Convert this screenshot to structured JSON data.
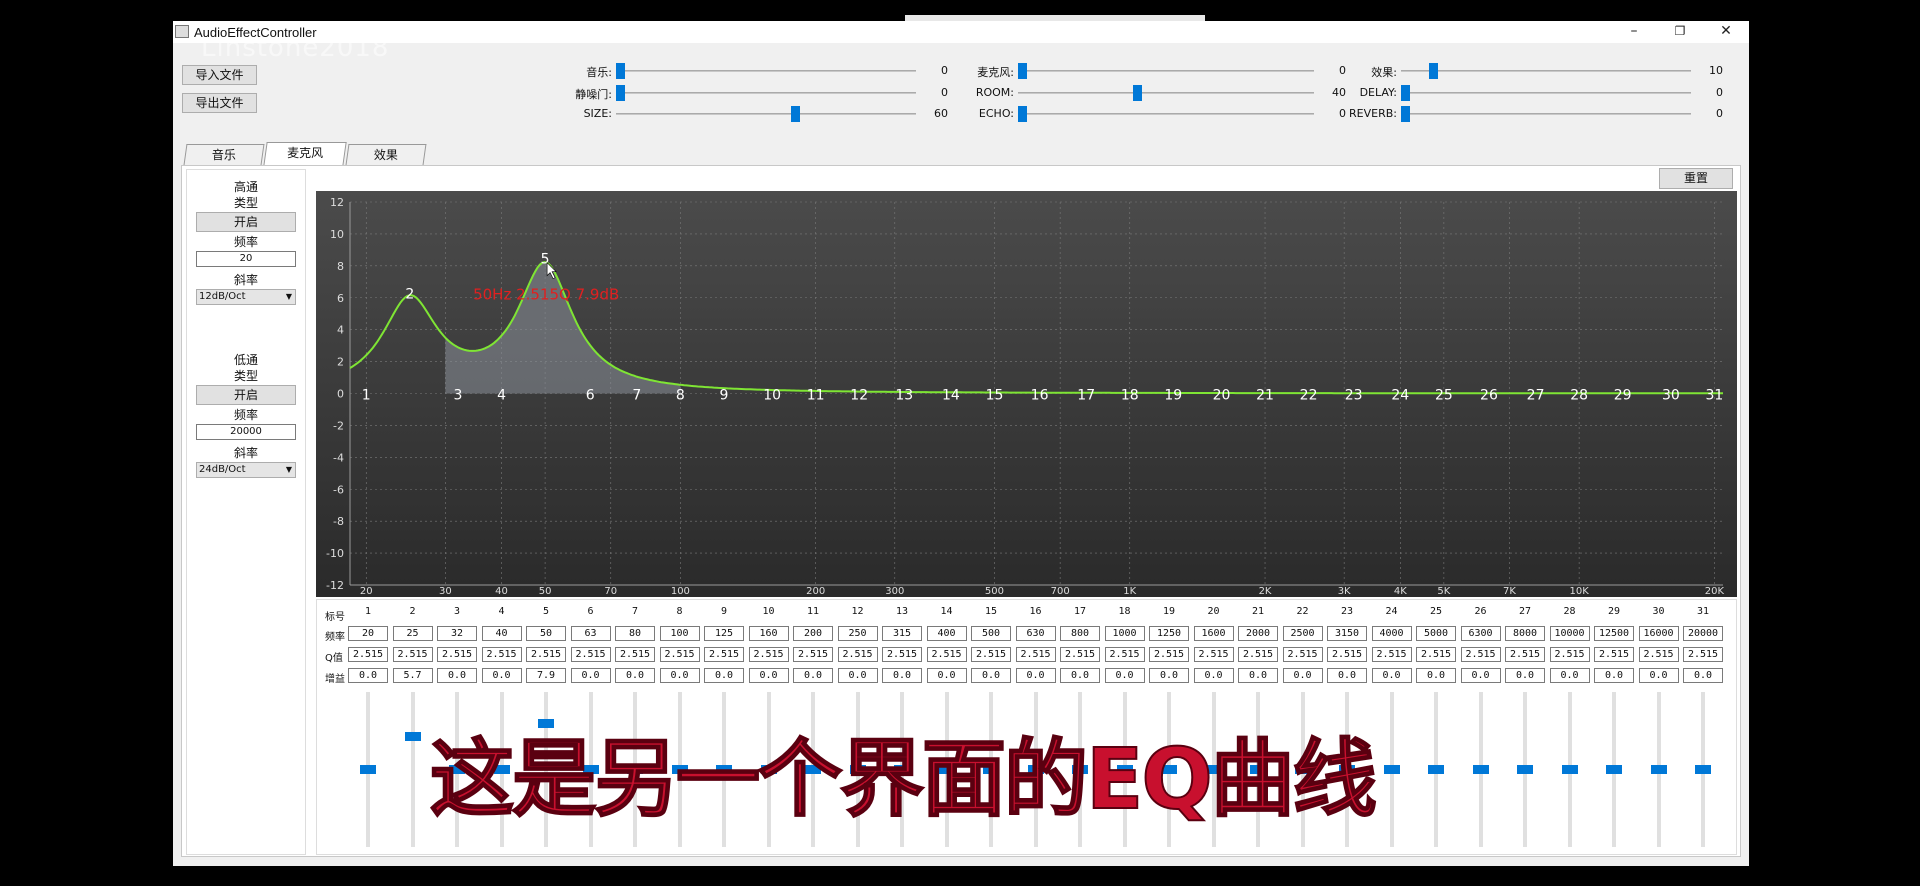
{
  "window": {
    "title": "AudioEffectController"
  },
  "watermark": "Linstone2018",
  "buttons": {
    "import": "导入文件",
    "export": "导出文件",
    "reset": "重置"
  },
  "sliders": [
    {
      "label": "音乐:",
      "value": "0",
      "level": 0.0
    },
    {
      "label": "麦克风:",
      "value": "0",
      "level": 0.0
    },
    {
      "label": "效果:",
      "value": "10",
      "level": 0.1
    },
    {
      "label": "静噪门:",
      "value": "0",
      "level": 0.0
    },
    {
      "label": "ROOM:",
      "value": "40",
      "level": 0.4
    },
    {
      "label": "DELAY:",
      "value": "0",
      "level": 0.0
    },
    {
      "label": "SIZE:",
      "value": "60",
      "level": 0.6
    },
    {
      "label": "ECHO:",
      "value": "0",
      "level": 0.0
    },
    {
      "label": "REVERB:",
      "value": "0",
      "level": 0.0
    }
  ],
  "tabs": [
    "音乐",
    "麦克风",
    "效果"
  ],
  "active_tab": "麦克风",
  "left_panel": {
    "highpass": {
      "title": "高通",
      "type_label": "类型",
      "button": "开启",
      "freq_label": "频率",
      "freq_value": "20",
      "slope_label": "斜率",
      "slope_value": "12dB/Oct"
    },
    "lowpass": {
      "title": "低通",
      "type_label": "类型",
      "button": "开启",
      "freq_label": "频率",
      "freq_value": "20000",
      "slope_label": "斜率",
      "slope_value": "24dB/Oct"
    }
  },
  "chart_data": {
    "type": "line",
    "yticks": [
      "12",
      "10",
      "8",
      "6",
      "4",
      "2",
      "0",
      "-2",
      "-4",
      "-6",
      "-8",
      "-10",
      "-12"
    ],
    "ylim": [
      -12,
      12
    ],
    "xscale": "log",
    "xticks": [
      "20",
      "30",
      "40",
      "50",
      "70",
      "100",
      "200",
      "300",
      "500",
      "700",
      "1K",
      "2K",
      "3K",
      "4K",
      "5K",
      "7K",
      "10K",
      "20K"
    ],
    "xtick_values": [
      20,
      30,
      40,
      50,
      70,
      100,
      200,
      300,
      500,
      700,
      1000,
      2000,
      3000,
      4000,
      5000,
      7000,
      10000,
      20000
    ],
    "tooltip": "50Hz 2.515Q 7.9dB",
    "point_freqs": [
      20,
      25,
      32,
      40,
      50,
      63,
      80,
      100,
      125,
      160,
      200,
      250,
      315,
      400,
      500,
      630,
      800,
      1000,
      1250,
      1600,
      2000,
      2500,
      3150,
      4000,
      5000,
      6300,
      8000,
      10000,
      12500,
      16000,
      20000
    ],
    "point_gains": [
      0.0,
      5.7,
      0.0,
      0.0,
      7.9,
      0.0,
      0.0,
      0.0,
      0.0,
      0.0,
      0.0,
      0.0,
      0.0,
      0.0,
      0.0,
      0.0,
      0.0,
      0.0,
      0.0,
      0.0,
      0.0,
      0.0,
      0.0,
      0.0,
      0.0,
      0.0,
      0.0,
      0.0,
      0.0,
      0.0,
      0.0
    ],
    "curve_color": "#7fe534",
    "tooltip_color": "#e02020",
    "grid": true
  },
  "bands": {
    "row_labels": {
      "index": "标号",
      "freq": "频率",
      "q": "Q值",
      "gain": "增益"
    },
    "index": [
      "1",
      "2",
      "3",
      "4",
      "5",
      "6",
      "7",
      "8",
      "9",
      "10",
      "11",
      "12",
      "13",
      "14",
      "15",
      "16",
      "17",
      "18",
      "19",
      "20",
      "21",
      "22",
      "23",
      "24",
      "25",
      "26",
      "27",
      "28",
      "29",
      "30",
      "31"
    ],
    "freq": [
      "20",
      "25",
      "32",
      "40",
      "50",
      "63",
      "80",
      "100",
      "125",
      "160",
      "200",
      "250",
      "315",
      "400",
      "500",
      "630",
      "800",
      "1000",
      "1250",
      "1600",
      "2000",
      "2500",
      "3150",
      "4000",
      "5000",
      "6300",
      "8000",
      "10000",
      "12500",
      "16000",
      "20000"
    ],
    "q": [
      "2.515",
      "2.515",
      "2.515",
      "2.515",
      "2.515",
      "2.515",
      "2.515",
      "2.515",
      "2.515",
      "2.515",
      "2.515",
      "2.515",
      "2.515",
      "2.515",
      "2.515",
      "2.515",
      "2.515",
      "2.515",
      "2.515",
      "2.515",
      "2.515",
      "2.515",
      "2.515",
      "2.515",
      "2.515",
      "2.515",
      "2.515",
      "2.515",
      "2.515",
      "2.515",
      "2.515"
    ],
    "gain": [
      "0.0",
      "5.7",
      "0.0",
      "0.0",
      "7.9",
      "0.0",
      "0.0",
      "0.0",
      "0.0",
      "0.0",
      "0.0",
      "0.0",
      "0.0",
      "0.0",
      "0.0",
      "0.0",
      "0.0",
      "0.0",
      "0.0",
      "0.0",
      "0.0",
      "0.0",
      "0.0",
      "0.0",
      "0.0",
      "0.0",
      "0.0",
      "0.0",
      "0.0",
      "0.0",
      "0.0"
    ]
  },
  "caption": "这是另一个界面的EQ曲线",
  "colors": {
    "accent": "#0078d7",
    "caption": "#c8102e"
  }
}
